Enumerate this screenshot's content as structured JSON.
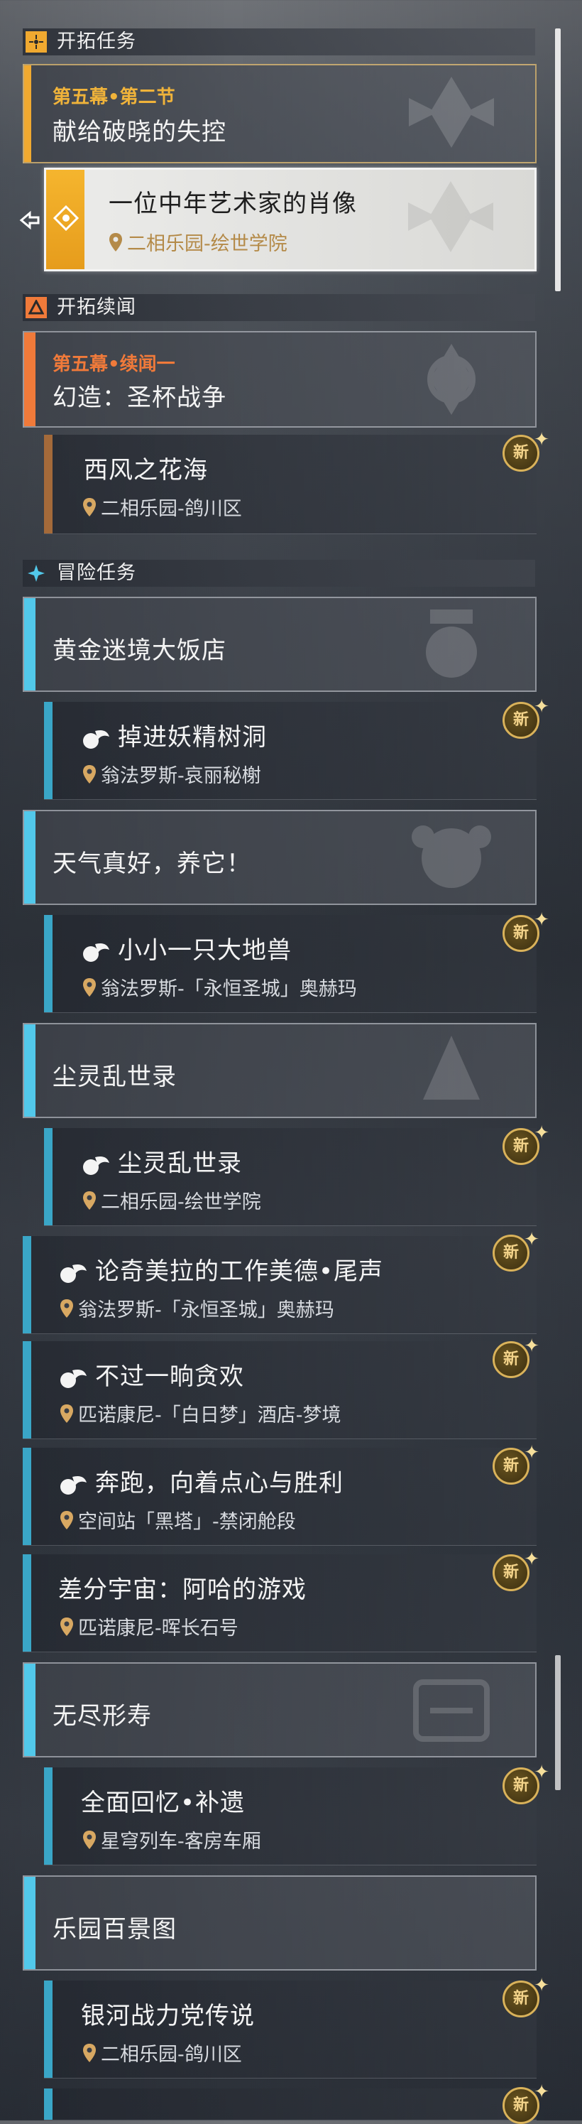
{
  "colors": {
    "gold": "#f0a930",
    "orange": "#f07a3a",
    "blue": "#52c8ea",
    "teal": "#3aa6c7",
    "brown": "#a46a3a",
    "selected_text": "#1e1e1e"
  },
  "sections": {
    "trailblaze": {
      "title": "开拓任务",
      "icon": "trailblaze-icon"
    },
    "companion": {
      "title": "开拓续闻",
      "icon": "companion-icon"
    },
    "adventure": {
      "title": "冒险任务",
      "icon": "adventure-icon"
    }
  },
  "cards": {
    "act5_ch2": {
      "subtitle": "第五幕•第二节",
      "title": "献给破晓的失控"
    },
    "portrait": {
      "title": "一位中年艺术家的肖像",
      "location": "二相乐园-绘世学院"
    },
    "act5_side1": {
      "subtitle": "第五幕•续闻一",
      "title": "幻造：圣杯战争"
    },
    "xifeng": {
      "title": "西风之花海",
      "location": "二相乐园-鸽川区",
      "badge": "新"
    },
    "golden": {
      "title": "黄金迷境大饭店"
    },
    "yaojing": {
      "title": "掉进妖精树洞",
      "location": "翁法罗斯-哀丽秘榭",
      "badge": "新"
    },
    "weather": {
      "title": "天气真好，养它！"
    },
    "xiaoxiao": {
      "title": "小小一只大地兽",
      "location": "翁法罗斯-「永恒圣城」奥赫玛",
      "badge": "新"
    },
    "chenling_group": {
      "title": "尘灵乱世录"
    },
    "chenling": {
      "title": "尘灵乱世录",
      "location": "二相乐园-绘世学院",
      "badge": "新"
    },
    "chimera": {
      "title": "论奇美拉的工作美德•尾声",
      "location": "翁法罗斯-「永恒圣城」奥赫玛",
      "badge": "新"
    },
    "buguo": {
      "title": "不过一晌贪欢",
      "location": "匹诺康尼-「白日梦」酒店-梦境",
      "badge": "新"
    },
    "benpao": {
      "title": "奔跑，向着点心与胜利",
      "location": "空间站「黑塔」-禁闭舱段",
      "badge": "新"
    },
    "chafen": {
      "title": "差分宇宙：阿哈的游戏",
      "location": "匹诺康尼-晖长石号",
      "badge": "新"
    },
    "wujin": {
      "title": "无尽形寿"
    },
    "quanmian": {
      "title": "全面回忆•补遗",
      "location": "星穹列车-客房车厢",
      "badge": "新"
    },
    "leyuan": {
      "title": "乐园百景图"
    },
    "yinhe": {
      "title": "银河战力党传说",
      "location": "二相乐园-鸽川区",
      "badge": "新"
    },
    "last": {
      "badge": "新"
    }
  }
}
